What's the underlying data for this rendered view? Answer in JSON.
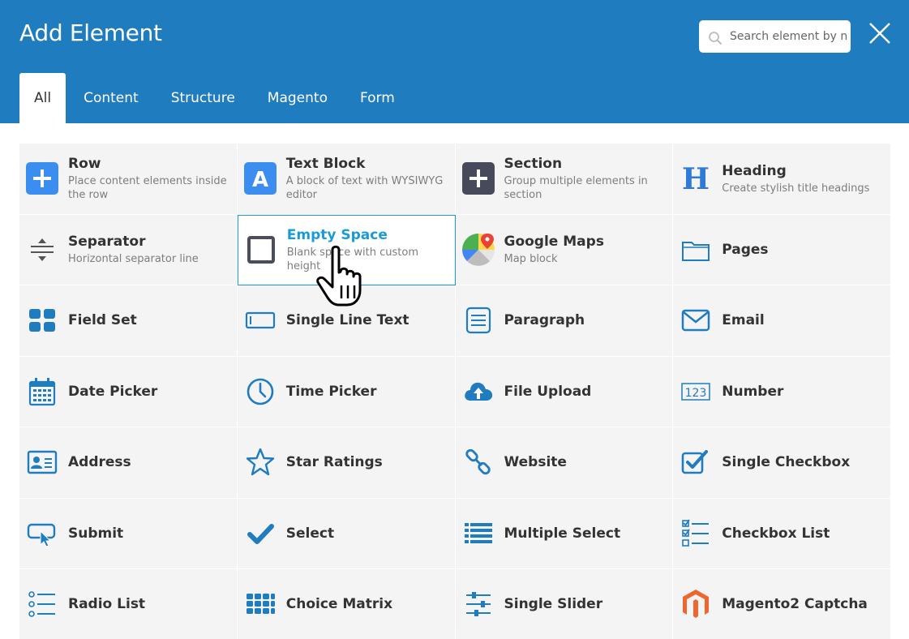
{
  "dialog": {
    "title": "Add Element",
    "search_placeholder": "Search element by name",
    "accent_color": "#1f7cbf",
    "highlight_color": "#1a9bd7"
  },
  "tabs": [
    {
      "label": "All",
      "active": true
    },
    {
      "label": "Content",
      "active": false
    },
    {
      "label": "Structure",
      "active": false
    },
    {
      "label": "Magento",
      "active": false
    },
    {
      "label": "Form",
      "active": false
    }
  ],
  "elements": [
    {
      "name": "Row",
      "desc": "Place content elements inside the row",
      "icon": "plus-square-icon"
    },
    {
      "name": "Text Block",
      "desc": "A block of text with WYSIWYG editor",
      "icon": "letter-a-icon"
    },
    {
      "name": "Section",
      "desc": "Group multiple elements in section",
      "icon": "plus-square-dark-icon"
    },
    {
      "name": "Heading",
      "desc": "Create stylish title headings",
      "icon": "heading-h-icon"
    },
    {
      "name": "Separator",
      "desc": "Horizontal separator line",
      "icon": "separator-icon"
    },
    {
      "name": "Empty Space",
      "desc": "Blank space with custom height",
      "icon": "empty-square-icon",
      "highlighted": true
    },
    {
      "name": "Google Maps",
      "desc": "Map block",
      "icon": "google-maps-icon"
    },
    {
      "name": "Pages",
      "desc": "",
      "icon": "pages-folder-icon"
    },
    {
      "name": "Field Set",
      "desc": "",
      "icon": "fieldset-grid-icon"
    },
    {
      "name": "Single Line Text",
      "desc": "",
      "icon": "text-input-icon"
    },
    {
      "name": "Paragraph",
      "desc": "",
      "icon": "paragraph-icon"
    },
    {
      "name": "Email",
      "desc": "",
      "icon": "envelope-icon"
    },
    {
      "name": "Date Picker",
      "desc": "",
      "icon": "calendar-icon"
    },
    {
      "name": "Time Picker",
      "desc": "",
      "icon": "clock-icon"
    },
    {
      "name": "File Upload",
      "desc": "",
      "icon": "cloud-upload-icon"
    },
    {
      "name": "Number",
      "desc": "",
      "icon": "number-123-icon"
    },
    {
      "name": "Address",
      "desc": "",
      "icon": "address-card-icon"
    },
    {
      "name": "Star Ratings",
      "desc": "",
      "icon": "star-icon"
    },
    {
      "name": "Website",
      "desc": "",
      "icon": "link-icon"
    },
    {
      "name": "Single Checkbox",
      "desc": "",
      "icon": "checkbox-icon"
    },
    {
      "name": "Submit",
      "desc": "",
      "icon": "submit-cursor-icon"
    },
    {
      "name": "Select",
      "desc": "",
      "icon": "checkmark-icon"
    },
    {
      "name": "Multiple Select",
      "desc": "",
      "icon": "list-icon"
    },
    {
      "name": "Checkbox List",
      "desc": "",
      "icon": "checkbox-list-icon"
    },
    {
      "name": "Radio List",
      "desc": "",
      "icon": "radio-list-icon"
    },
    {
      "name": "Choice Matrix",
      "desc": "",
      "icon": "matrix-grid-icon"
    },
    {
      "name": "Single Slider",
      "desc": "",
      "icon": "sliders-icon"
    },
    {
      "name": "Magento2 Captcha",
      "desc": "",
      "icon": "magento-logo-icon"
    }
  ]
}
